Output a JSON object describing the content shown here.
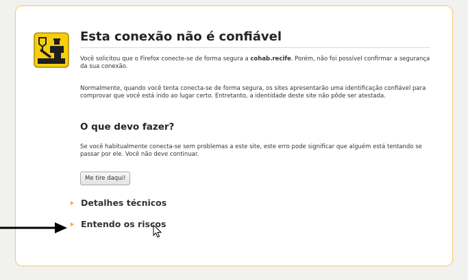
{
  "page": {
    "title": "Esta conexão não é confiável",
    "intro_before": "Você solicitou que o Firefox conecte-se de forma segura a ",
    "host": "cohab.recife",
    "intro_after": ". Porém, não foi possível confirmar a segurança da sua conexão.",
    "explanation": "Normalmente, quando você tenta conecta-se de forma segura, os sites apresentarão uma identificação confiável para comprovar que você está indo ao lugar certo. Entretanto, a identidade deste site não pôde ser atestada.",
    "what_to_do_heading": "O que devo fazer?",
    "advice": "Se você habitualmente conecta-se sem problemas a este site, este erro pode significar que alguém está tentando se passar por ele. Você não deve continuar.",
    "back_button_label": "Me tire daqui!",
    "technical_details_label": "Detalhes técnicos",
    "understand_risks_label": "Entendo os riscos"
  },
  "icons": {
    "warning": "policeman-warning-icon",
    "pointer": "arrow-pointer-icon",
    "cursor": "mouse-cursor-icon"
  },
  "colors": {
    "accent_border": "#f0c869",
    "expander_triangle": "#f0ac3a",
    "icon_yellow": "#f5cf0e"
  }
}
